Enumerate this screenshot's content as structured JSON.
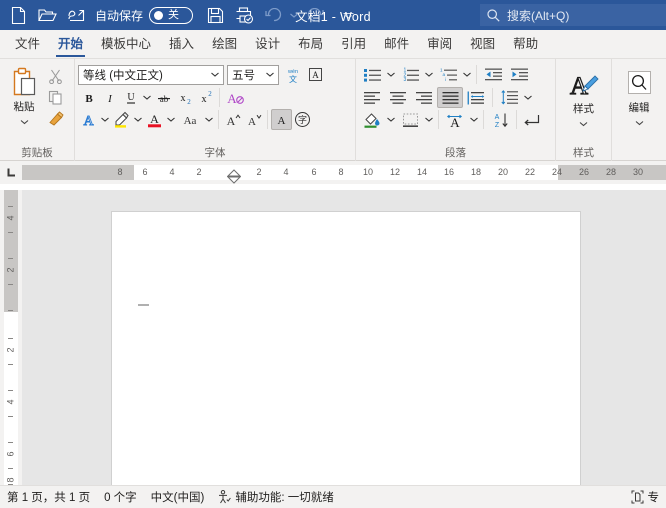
{
  "titlebar": {
    "quick_access": [
      {
        "name": "new-document-icon",
        "label": "新建"
      },
      {
        "name": "open-folder-icon",
        "label": "打开"
      },
      {
        "name": "touch-mode-icon",
        "label": "触摸/鼠标模式"
      }
    ],
    "autosave_label": "自动保存",
    "autosave_state": "关",
    "save_icon_label": "保存",
    "print_preview_icon_label": "打印预览和打印",
    "undo_label": "撤消",
    "redo_label": "恢复",
    "customize_label": "自定义快速访问工具栏",
    "document_title": "文档1  -  Word",
    "search_placeholder": "搜索(Alt+Q)",
    "accent_color": "#2b579a"
  },
  "tabs": [
    {
      "label": "文件",
      "active": false
    },
    {
      "label": "开始",
      "active": true
    },
    {
      "label": "模板中心",
      "active": false
    },
    {
      "label": "插入",
      "active": false
    },
    {
      "label": "绘图",
      "active": false
    },
    {
      "label": "设计",
      "active": false
    },
    {
      "label": "布局",
      "active": false
    },
    {
      "label": "引用",
      "active": false
    },
    {
      "label": "邮件",
      "active": false
    },
    {
      "label": "审阅",
      "active": false
    },
    {
      "label": "视图",
      "active": false
    },
    {
      "label": "帮助",
      "active": false
    }
  ],
  "ribbon": {
    "clipboard": {
      "title": "剪贴板",
      "paste_label": "粘贴",
      "cut_label": "剪切",
      "copy_label": "复制",
      "format_painter_label": "格式刷",
      "dialog_launcher_label": "剪贴板对话框启动器"
    },
    "font": {
      "title": "字体",
      "font_name_value": "等线 (中文正文)",
      "font_size_value": "五号",
      "phonetic_guide_label": "拼音指南",
      "char_border_label": "字符边框",
      "bold_label": "加粗",
      "italic_label": "倾斜",
      "underline_label": "下划线",
      "strikethrough_label": "删除线",
      "subscript_label": "下标",
      "superscript_label": "上标",
      "clear_format_label": "清除所有格式",
      "text_effects_label": "文本效果和版式",
      "highlight_label": "以不同颜色突出显示文本",
      "font_color_label": "字体颜色",
      "change_case_label": "更改大小写",
      "grow_font_label": "增大字号",
      "shrink_font_label": "减小字号",
      "char_shading_label": "字符底纹",
      "enclose_char_label": "带圈字符",
      "dialog_launcher_label": "字体对话框启动器"
    },
    "paragraph": {
      "title": "段落",
      "bullets_label": "项目符号",
      "numbering_label": "编号",
      "multilevel_label": "多级列表",
      "decrease_indent_label": "减少缩进量",
      "increase_indent_label": "增加缩进量",
      "align_left_label": "左对齐",
      "align_center_label": "居中",
      "align_right_label": "右对齐",
      "justify_label": "两端对齐",
      "distribute_label": "分散对齐",
      "line_spacing_label": "行和段落间距",
      "shading_label": "底纹",
      "borders_label": "边框",
      "asian_layout_label": "中文版式",
      "sort_label": "排序",
      "show_marks_label": "显示/隐藏编辑标记",
      "dialog_launcher_label": "段落对话框启动器"
    },
    "styles": {
      "title": "样式",
      "button_label": "样式",
      "dialog_launcher_label": "样式对话框启动器"
    },
    "editing": {
      "title": "",
      "button_label": "编辑"
    }
  },
  "ruler": {
    "tab_stop_label": "左对齐式制表符",
    "horizontal_numbers": [
      "8",
      "6",
      "4",
      "2",
      "2",
      "4",
      "6",
      "8",
      "10",
      "12",
      "14",
      "16",
      "18",
      "20",
      "22",
      "24",
      "26",
      "28",
      "30"
    ],
    "vertical_numbers": [
      "4",
      "2",
      "2",
      "4",
      "6",
      "8"
    ],
    "left_indent_marker_label": "首行缩进标记",
    "right_indent_marker_label": "右缩进标记"
  },
  "statusbar": {
    "page_info": "第 1 页，共 1 页",
    "word_count": "0 个字",
    "language": "中文(中国)",
    "accessibility_icon": "accessibility-icon",
    "accessibility_text": "辅助功能: 一切就绪",
    "focus_mode_label": "专"
  }
}
